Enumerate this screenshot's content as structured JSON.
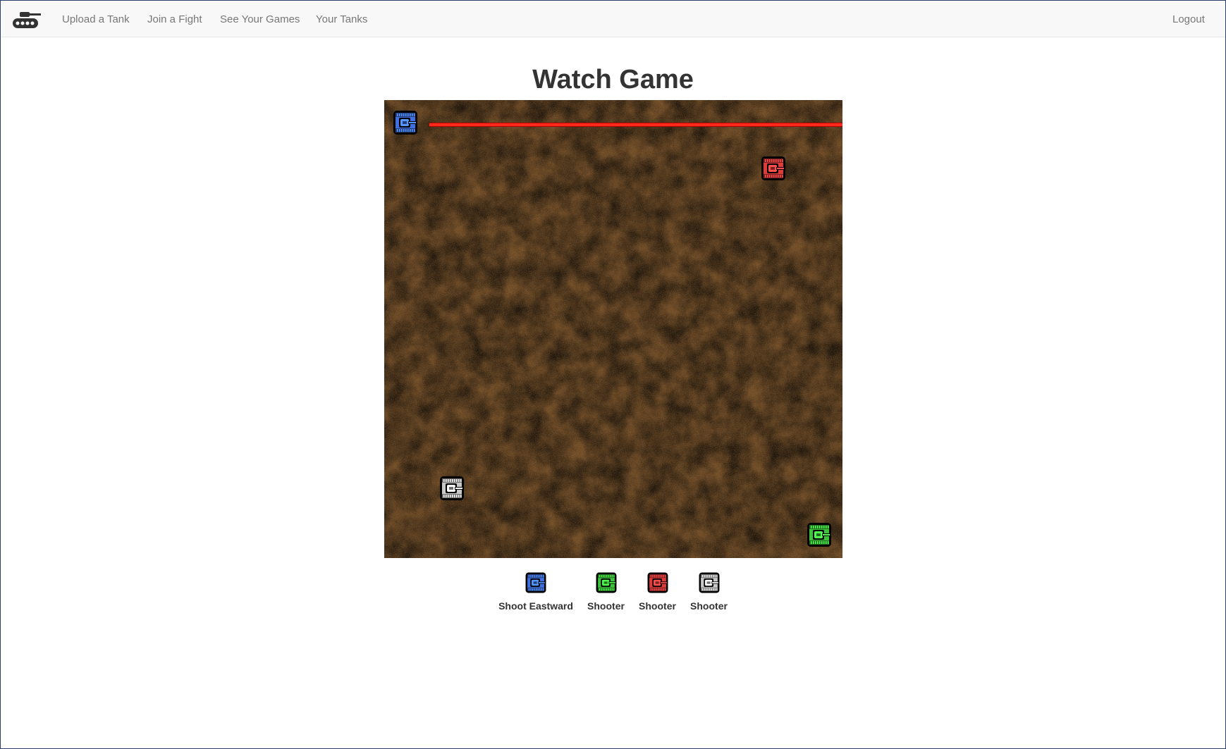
{
  "nav": {
    "brand_icon": "tank-logo-icon",
    "links": [
      "Upload a Tank",
      "Join a Fight",
      "See Your Games",
      "Your Tanks"
    ],
    "logout": "Logout"
  },
  "page": {
    "title": "Watch Game"
  },
  "arena": {
    "background": "dirt-texture",
    "laser_color": "#ff2a1a"
  },
  "tanks": [
    {
      "color": "#3f6fe0",
      "icon": "blue-tank-icon"
    },
    {
      "color": "#e03a3a",
      "icon": "red-tank-icon"
    },
    {
      "color": "#c8c8c8",
      "icon": "gray-tank-icon"
    },
    {
      "color": "#3cc23c",
      "icon": "green-tank-icon"
    }
  ],
  "legend": [
    {
      "name": "Shoot Eastward",
      "color": "#3f6fe0",
      "icon": "blue-tank-icon"
    },
    {
      "name": "Shooter",
      "color": "#3cc23c",
      "icon": "green-tank-icon"
    },
    {
      "name": "Shooter",
      "color": "#e03a3a",
      "icon": "red-tank-icon"
    },
    {
      "name": "Shooter",
      "color": "#c8c8c8",
      "icon": "gray-tank-icon"
    }
  ]
}
